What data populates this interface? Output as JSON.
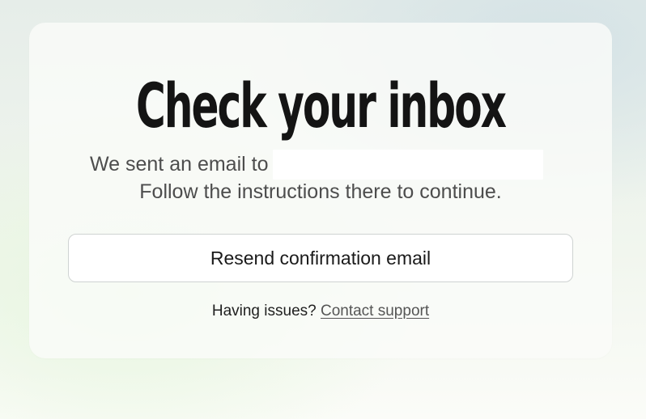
{
  "card": {
    "title": "Check your inbox",
    "sent_prefix": "We sent an email to",
    "email_value": "",
    "instructions": "Follow the instructions there to continue.",
    "resend_label": "Resend confirmation email",
    "help_prefix": "Having issues?",
    "support_link": "Contact support"
  }
}
